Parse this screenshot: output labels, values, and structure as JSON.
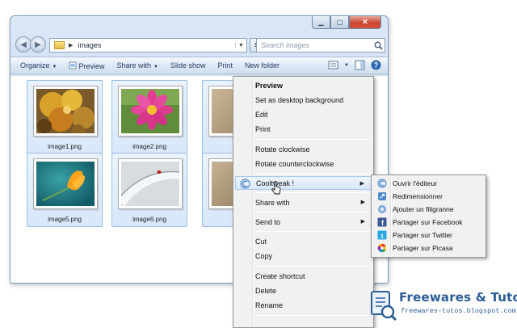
{
  "window": {
    "address": {
      "path": "images"
    },
    "search": {
      "placeholder": "Search images"
    }
  },
  "command_bar": {
    "organize": "Organize",
    "preview": "Preview",
    "share_with": "Share with",
    "slide_show": "Slide show",
    "print": "Print",
    "new_folder": "New folder"
  },
  "files": [
    {
      "name": "image1.png",
      "icon": "autumn-leaves-thumbnail"
    },
    {
      "name": "image2.png",
      "icon": "pink-flower-thumbnail"
    },
    {
      "name": "",
      "icon": "beige-photo-thumbnail"
    },
    {
      "name": "image5.png",
      "icon": "yellow-flower-thumbnail"
    },
    {
      "name": "image6.png",
      "icon": "ladybug-thumbnail"
    },
    {
      "name": "",
      "icon": "beige-photo-thumbnail"
    }
  ],
  "context_menu": {
    "preview": "Preview",
    "set_background": "Set as desktop background",
    "edit": "Edit",
    "print": "Print",
    "rotate_cw": "Rotate clockwise",
    "rotate_ccw": "Rotate counterclockwise",
    "cooltweak": "Cooltweak !",
    "share_with": "Share with",
    "send_to": "Send to",
    "cut": "Cut",
    "copy": "Copy",
    "create_shortcut": "Create shortcut",
    "delete": "Delete",
    "rename": "Rename"
  },
  "submenu": {
    "open_editor": "Ouvrir l'éditeur",
    "resize": "Redimensionner",
    "watermark": "Ajouter un filigranne",
    "facebook": "Partager sur Facebook",
    "twitter": "Partager sur Twitter",
    "picasa": "Partager sur Picasa"
  },
  "watermark": {
    "title": "Freewares & Tutos",
    "url": "freewares-tutos.blogspot.com"
  },
  "colors": {
    "facebook": "#3b5998",
    "twitter": "#2aa9e0",
    "selection_border": "#96bde7",
    "brand": "#2c5d97"
  }
}
